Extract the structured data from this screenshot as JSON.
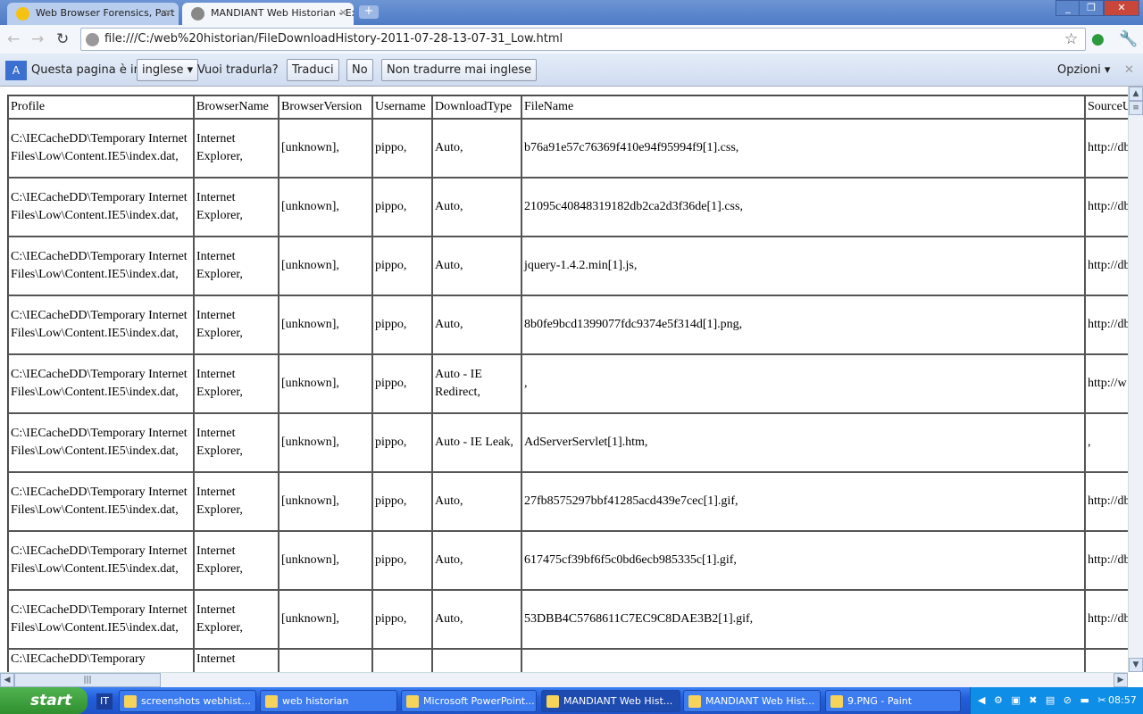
{
  "browser": {
    "tabs": [
      {
        "label": "Web Browser Forensics, Part",
        "icon": "norton-check-icon"
      },
      {
        "label": "MANDIANT Web Historian - Ex",
        "icon": "globe-icon",
        "active": true
      }
    ],
    "url": "file:///C:/web%20historian/FileDownloadHistory-2011-07-28-13-07-31_Low.html"
  },
  "translate_bar": {
    "prompt": "Questa pagina è in",
    "language": "inglese",
    "question": "Vuoi tradurla?",
    "translate": "Traduci",
    "no": "No",
    "never": "Non tradurre mai inglese",
    "options": "Opzioni"
  },
  "table": {
    "headers": [
      "Profile",
      "BrowserName",
      "BrowserVersion",
      "Username",
      "DownloadType",
      "FileName",
      "SourceURL"
    ],
    "rows": [
      [
        "C:\\IECacheDD\\Temporary Internet Files\\Low\\Content.IE5\\index.dat,",
        "Internet Explorer,",
        "[unknown],",
        "pippo,",
        "Auto,",
        "b76a91e57c76369f410e94f95994f9[1].css,",
        "http://db"
      ],
      [
        "C:\\IECacheDD\\Temporary Internet Files\\Low\\Content.IE5\\index.dat,",
        "Internet Explorer,",
        "[unknown],",
        "pippo,",
        "Auto,",
        "21095c40848319182db2ca2d3f36de[1].css,",
        "http://db"
      ],
      [
        "C:\\IECacheDD\\Temporary Internet Files\\Low\\Content.IE5\\index.dat,",
        "Internet Explorer,",
        "[unknown],",
        "pippo,",
        "Auto,",
        "jquery-1.4.2.min[1].js,",
        "http://db"
      ],
      [
        "C:\\IECacheDD\\Temporary Internet Files\\Low\\Content.IE5\\index.dat,",
        "Internet Explorer,",
        "[unknown],",
        "pippo,",
        "Auto,",
        "8b0fe9bcd1399077fdc9374e5f314d[1].png,",
        "http://db"
      ],
      [
        "C:\\IECacheDD\\Temporary Internet Files\\Low\\Content.IE5\\index.dat,",
        "Internet Explorer,",
        "[unknown],",
        "pippo,",
        "Auto - IE Redirect,",
        ",",
        "http://w"
      ],
      [
        "C:\\IECacheDD\\Temporary Internet Files\\Low\\Content.IE5\\index.dat,",
        "Internet Explorer,",
        "[unknown],",
        "pippo,",
        "Auto - IE Leak,",
        "AdServerServlet[1].htm,",
        ","
      ],
      [
        "C:\\IECacheDD\\Temporary Internet Files\\Low\\Content.IE5\\index.dat,",
        "Internet Explorer,",
        "[unknown],",
        "pippo,",
        "Auto,",
        "27fb8575297bbf41285acd439e7cec[1].gif,",
        "http://db"
      ],
      [
        "C:\\IECacheDD\\Temporary Internet Files\\Low\\Content.IE5\\index.dat,",
        "Internet Explorer,",
        "[unknown],",
        "pippo,",
        "Auto,",
        "617475cf39bf6f5c0bd6ecb985335c[1].gif,",
        "http://db"
      ],
      [
        "C:\\IECacheDD\\Temporary Internet Files\\Low\\Content.IE5\\index.dat,",
        "Internet Explorer,",
        "[unknown],",
        "pippo,",
        "Auto,",
        "53DBB4C5768611C7EC9C8DAE3B2[1].gif,",
        "http://db"
      ],
      [
        "C:\\IECacheDD\\Temporary",
        "Internet",
        "",
        "",
        "",
        "",
        ""
      ]
    ]
  },
  "taskbar": {
    "start": "start",
    "lang": "IT",
    "tasks": [
      {
        "label": "screenshots webhist..."
      },
      {
        "label": "web historian"
      },
      {
        "label": "Microsoft PowerPoint..."
      },
      {
        "label": "MANDIANT Web Hist...",
        "active": true
      },
      {
        "label": "MANDIANT Web Hist..."
      },
      {
        "label": "9.PNG - Paint"
      }
    ],
    "clock": "08:57"
  }
}
